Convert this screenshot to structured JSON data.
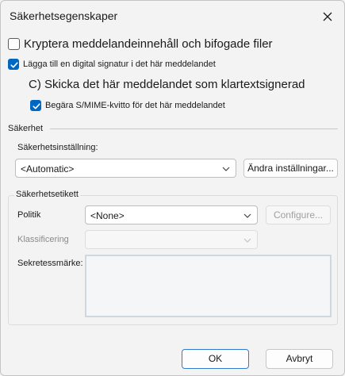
{
  "window": {
    "title": "Säkerhetsegenskaper"
  },
  "options": {
    "encrypt": {
      "label": "Kryptera meddelandeinnehåll och bifogade filer",
      "checked": false
    },
    "sign": {
      "label": "Lägga till en digital signatur i det här meddelandet",
      "checked": true
    },
    "cleartext": {
      "label": "C) Skicka det här meddelandet som klartextsignerad"
    },
    "receipt": {
      "label": "Begära S/MIME-kvitto för det här meddelandet",
      "checked": true
    }
  },
  "security": {
    "group_label": "Säkerhet",
    "setting_label": "Säkerhetsinställning:",
    "setting_value": "<Automatic>",
    "change_button": "Ändra inställningar..."
  },
  "label_group": {
    "group_label": "Säkerhetsetikett",
    "policy_label": "Politik",
    "policy_value": "<None>",
    "configure_button": "Configure...",
    "classification_label": "Klassificering",
    "classification_value": "",
    "privacy_label": "Sekretessmärke:"
  },
  "footer": {
    "ok": "OK",
    "cancel": "Avbryt"
  },
  "colors": {
    "accent": "#0067c0",
    "background": "#f3f3f3"
  }
}
